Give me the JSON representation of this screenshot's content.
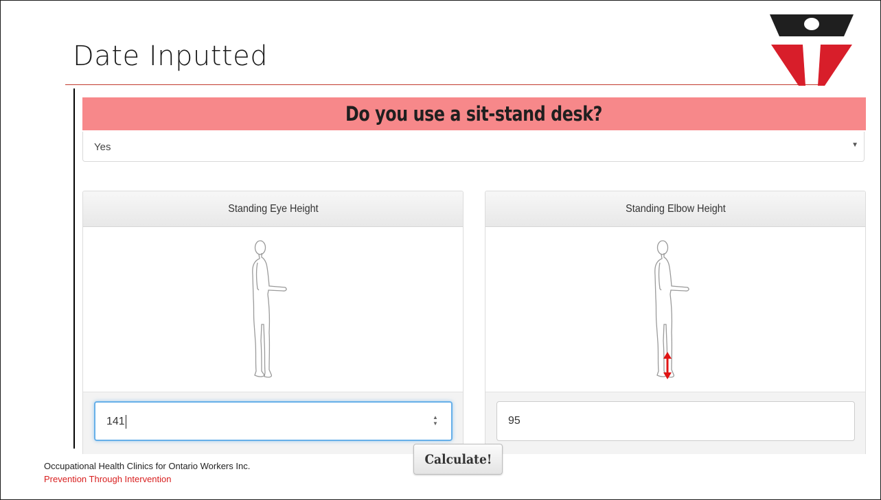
{
  "slide": {
    "title": "Date Inputted",
    "footer_org": "Occupational Health Clinics for Ontario Workers Inc.",
    "footer_tagline": "Prevention Through Intervention"
  },
  "form": {
    "question": "Do you use a sit-stand desk?",
    "select_value": "Yes",
    "panels": [
      {
        "label": "Standing Eye Height",
        "value": "141",
        "focused": true,
        "figure_icon": "standing-person-icon"
      },
      {
        "label": "Standing Elbow Height",
        "value": "95",
        "focused": false,
        "figure_icon": "standing-person-icon",
        "indicator_icon": "red-double-arrow-icon"
      }
    ],
    "calculate_label": "Calculate!"
  },
  "colors": {
    "banner": "#f7888a",
    "accent_red": "#d81e1e",
    "title_rule": "#c0392b",
    "focus_blue": "#66afe9"
  }
}
